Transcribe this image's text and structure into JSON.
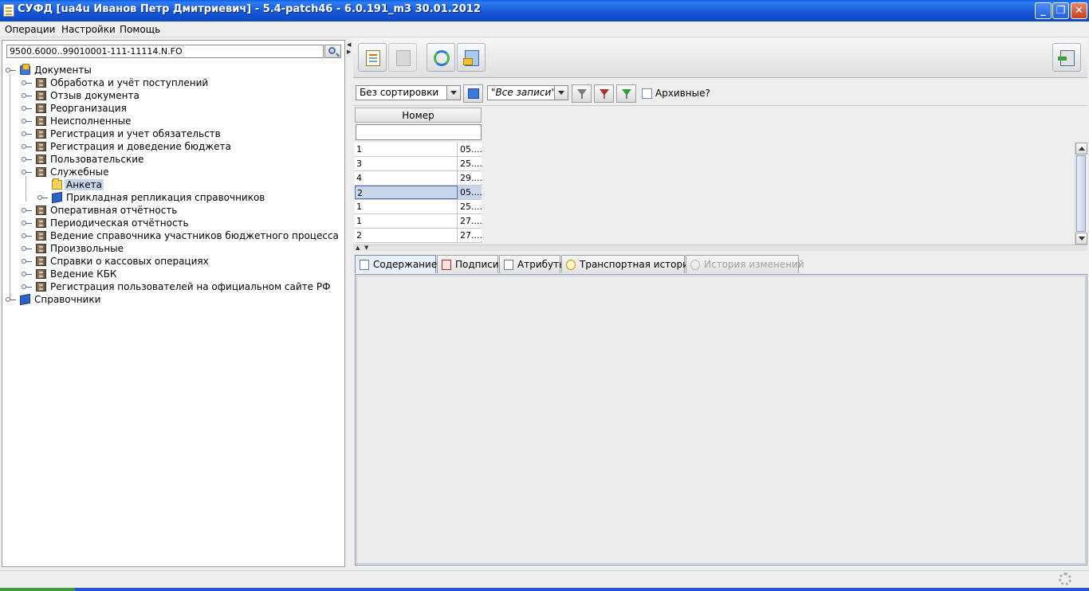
{
  "window": {
    "title": "СУФД [ua4u Иванов Петр Дмитриевич] - 5.4-patch46 - 6.0.191_m3 30.01.2012",
    "minimize": "_",
    "maximize": "❐",
    "close": "✕"
  },
  "menu": {
    "items": [
      "Операции",
      "Настройки",
      "Помощь"
    ]
  },
  "left": {
    "search_value": "9500.6000..99010001-111-11114.N.FO",
    "tree": {
      "root": "Документы",
      "children": [
        "Обработка и учёт поступлений",
        "Отзыв документа",
        "Реорганизация",
        "Неисполненные",
        "Регистрация и учет обязательств",
        "Регистрация и доведение бюджета",
        "Пользовательские",
        "Служебные"
      ],
      "service_children": [
        "Анкета",
        "Прикладная репликация справочников"
      ],
      "children_after": [
        "Оперативная отчётность",
        "Периодическая отчётность",
        "Ведение справочника участников бюджетного процесса",
        "Произвольные",
        "Справки о кассовых операциях",
        "Ведение КБК",
        "Регистрация пользователей на официальном сайте РФ"
      ],
      "root2": "Справочники"
    }
  },
  "filters": {
    "sort": "Без сортировки",
    "records": "\"Все записи\"",
    "archived_label": "Архивные?"
  },
  "table": {
    "column": "Номер",
    "rows": [
      {
        "num": "1",
        "date": "05...."
      },
      {
        "num": "3",
        "date": "25...."
      },
      {
        "num": "4",
        "date": "29...."
      },
      {
        "num": "2",
        "date": "05...."
      },
      {
        "num": "1",
        "date": "25...."
      },
      {
        "num": "1",
        "date": "27...."
      },
      {
        "num": "2",
        "date": "27...."
      }
    ]
  },
  "tabs": [
    "Содержание",
    "Подписи",
    "Атрибуты",
    "Транспортная история",
    "История изменений"
  ],
  "colors": {
    "titlebar": "#1457d8",
    "selection": "#c8d6ec",
    "close_button": "#c5401f"
  }
}
